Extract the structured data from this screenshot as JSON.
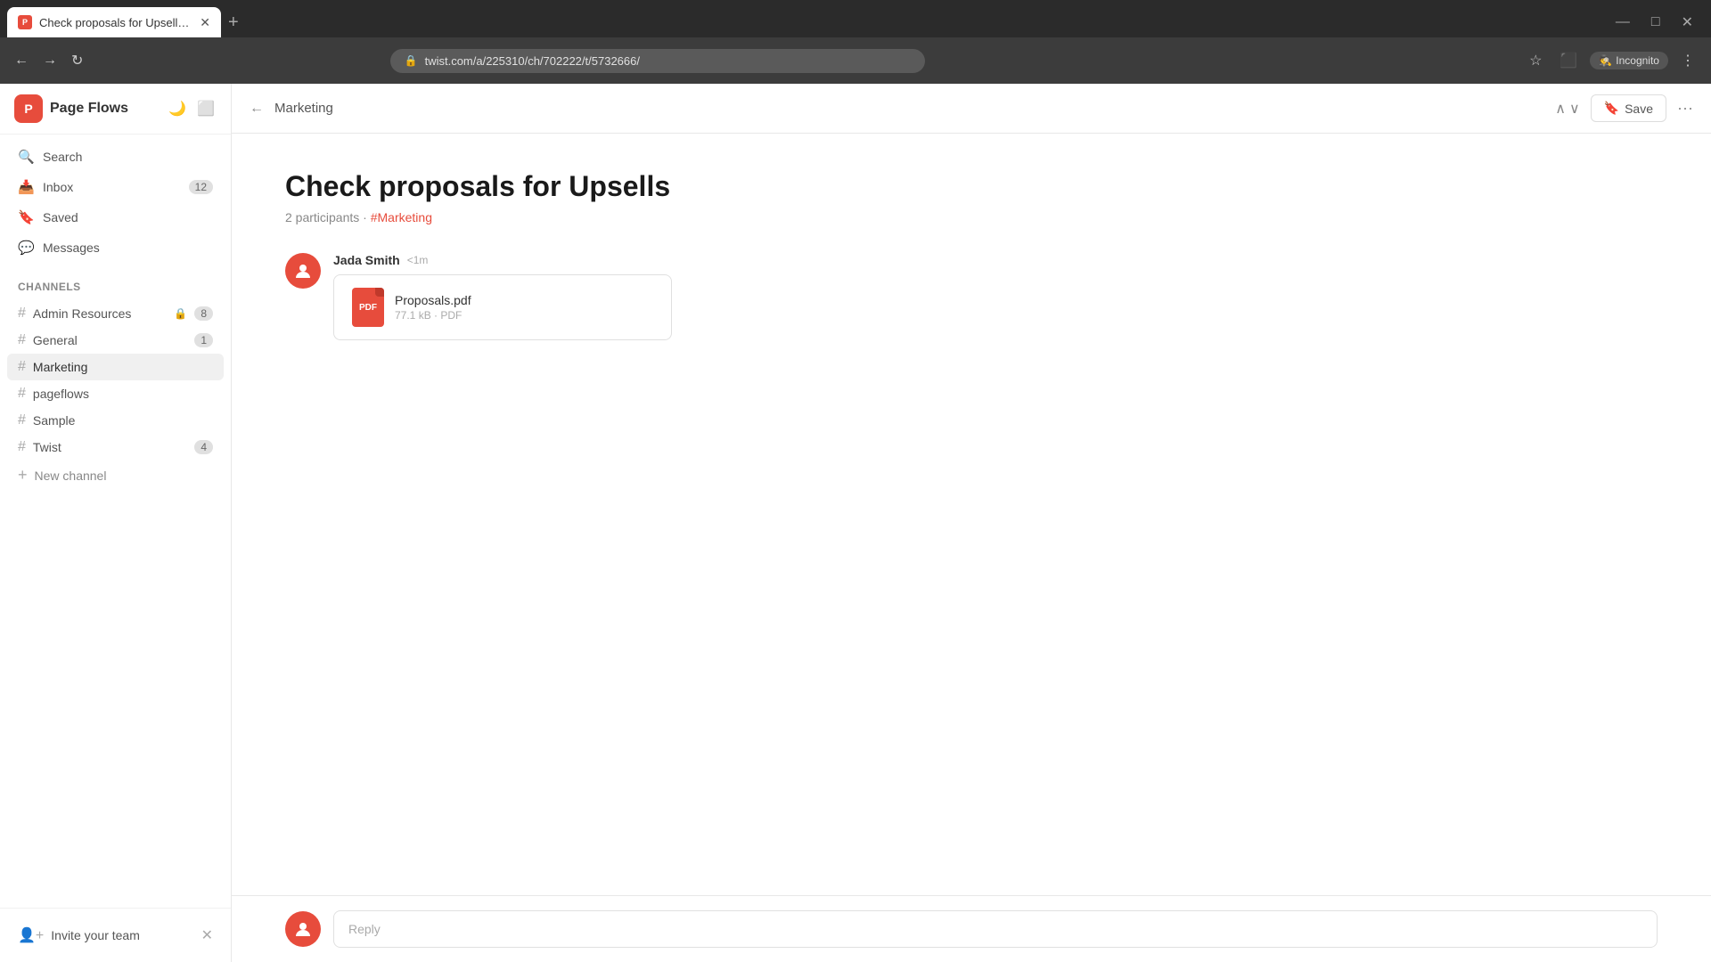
{
  "browser": {
    "tab": {
      "title": "Check proposals for Upsells · Pa...",
      "favicon": "P",
      "url": "twist.com/a/225310/ch/702222/t/5732666/"
    },
    "incognito_label": "Incognito"
  },
  "sidebar": {
    "logo_letter": "P",
    "app_name": "Page Flows",
    "nav_items": [
      {
        "icon": "🔍",
        "label": "Search"
      },
      {
        "icon": "📥",
        "label": "Inbox",
        "badge": "12"
      },
      {
        "icon": "🔖",
        "label": "Saved"
      },
      {
        "icon": "💬",
        "label": "Messages"
      }
    ],
    "channels_heading": "Channels",
    "channels": [
      {
        "label": "Admin Resources",
        "badge": "8",
        "locked": true
      },
      {
        "label": "General",
        "badge": "1"
      },
      {
        "label": "Marketing",
        "active": true
      },
      {
        "label": "pageflows"
      },
      {
        "label": "Sample"
      },
      {
        "label": "Twist",
        "badge": "4"
      }
    ],
    "add_channel_label": "New channel",
    "invite_label": "Invite your team"
  },
  "header": {
    "breadcrumb": "Marketing",
    "save_label": "Save"
  },
  "thread": {
    "title": "Check proposals for Upsells",
    "participants": "2 participants",
    "channel_tag": "#Marketing",
    "message": {
      "sender": "Jada Smith",
      "time": "<1m",
      "attachment": {
        "name": "Proposals.pdf",
        "size": "77.1 kB",
        "type": "PDF"
      }
    }
  },
  "reply": {
    "placeholder": "Reply"
  }
}
